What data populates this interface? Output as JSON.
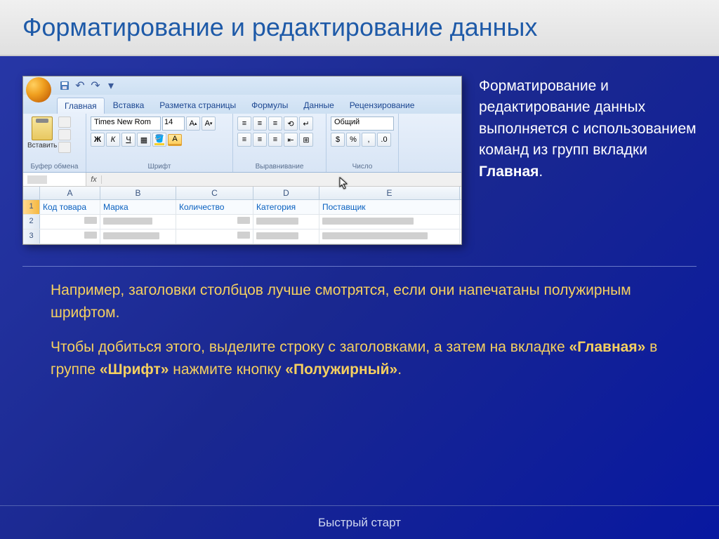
{
  "title": "Форматирование и редактирование данных",
  "excel": {
    "qat_icons": [
      "save-icon",
      "undo-icon",
      "redo-icon"
    ],
    "tabs": [
      "Главная",
      "Вставка",
      "Разметка страницы",
      "Формулы",
      "Данные",
      "Рецензирование"
    ],
    "active_tab": 0,
    "groups": {
      "clipboard": {
        "label": "Буфер обмена",
        "paste": "Вставить"
      },
      "font": {
        "label": "Шрифт",
        "font_name": "Times New Rom",
        "font_size": "14",
        "buttons": [
          "Ж",
          "К",
          "Ч"
        ]
      },
      "alignment": {
        "label": "Выравнивание"
      },
      "number": {
        "label": "Число",
        "format": "Общий"
      }
    },
    "columns": [
      "A",
      "B",
      "C",
      "D",
      "E"
    ],
    "headers_row": [
      "Код товара",
      "Марка",
      "Количество",
      "Категория",
      "Поставщик"
    ],
    "data_rows": 2
  },
  "side_paragraph_parts": {
    "p1a": "Форматирование и редактирование данных выполняется с использованием команд из групп вкладки ",
    "p1b": "Главная",
    "p1c": "."
  },
  "body": {
    "p1": "Например, заголовки столбцов лучше смотрятся, если они напечатаны полужирным шрифтом.",
    "p2a": "Чтобы добиться этого, выделите строку с заголовками, а затем на вкладке ",
    "p2b": "«Главная»",
    "p2c": " в группе ",
    "p2d": "«Шрифт»",
    "p2e": " нажмите кнопку ",
    "p2f": "«Полужирный»",
    "p2g": "."
  },
  "footer": "Быстрый старт"
}
